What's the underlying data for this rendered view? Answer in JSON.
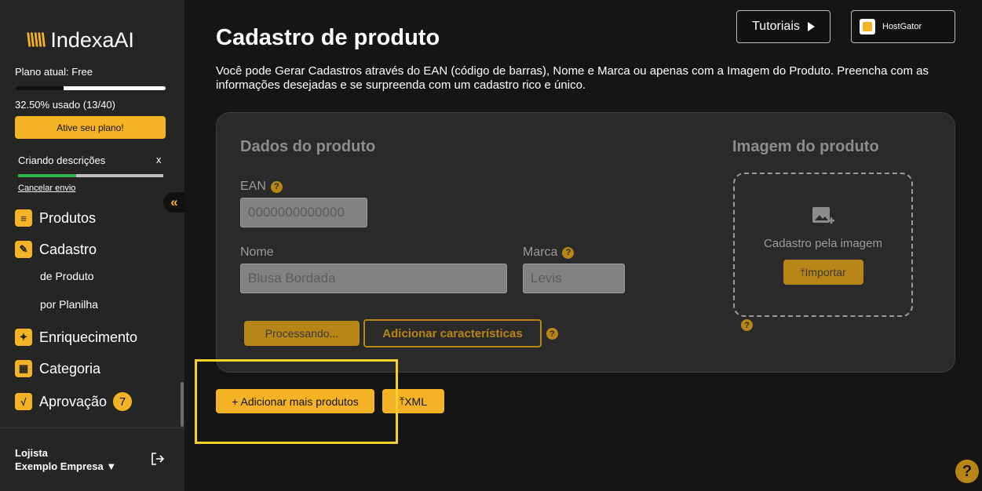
{
  "brand": {
    "name": "IndexaAI",
    "accent": "#f4b324"
  },
  "plan": {
    "label": "Plano atual: Free",
    "usage_fraction": 0.325,
    "usage_text": "32.50% usado (13/40)",
    "activate_label": "Ative seu plano!"
  },
  "job": {
    "label": "Criando descrições",
    "close_label": "x",
    "progress_fraction": 0.4,
    "cancel_label": "Cancelar envio"
  },
  "nav": {
    "produtos": "Produtos",
    "cadastro": "Cadastro",
    "sub_produto": "de Produto",
    "sub_planilha": "por Planilha",
    "enriquecimento": "Enriquecimento",
    "categoria": "Categoria",
    "aprovacao": "Aprovação",
    "aprovacao_count": "7"
  },
  "user": {
    "role": "Lojista",
    "company": "Exemplo Empresa ▼"
  },
  "header": {
    "title": "Cadastro de produto",
    "description": "Você pode Gerar Cadastros através do EAN (código de barras), Nome e Marca ou apenas com a Imagem do Produto. Preencha com as informações desejadas e se surpreenda com um cadastro rico e único.",
    "tutorials_label": "Tutoriais",
    "store_label": "HostGator"
  },
  "form": {
    "section_title": "Dados do produto",
    "ean_label": "EAN",
    "ean_placeholder": "0000000000000",
    "name_label": "Nome",
    "name_placeholder": "Blusa Bordada",
    "brand_label": "Marca",
    "brand_placeholder": "Levis",
    "processing_label": "Processando...",
    "characteristics_label": "Adicionar características",
    "help_glyph": "?"
  },
  "image": {
    "section_title": "Imagem do produto",
    "drop_label": "Cadastro pela imagem",
    "import_label": "Importar"
  },
  "actions": {
    "add_more_label": "+ Adicionar mais produtos",
    "xml_label": "XML"
  },
  "help_fab": "?"
}
